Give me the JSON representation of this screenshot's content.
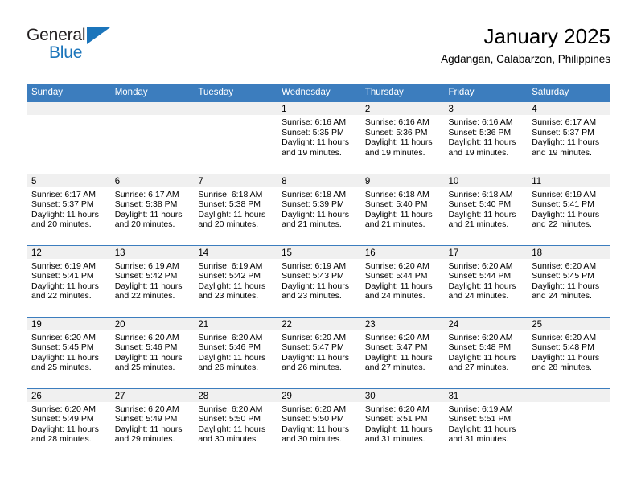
{
  "logo": {
    "word_one": "General",
    "word_two": "Blue",
    "triangle_icon": "triangle-icon",
    "accent_color": "#1b75bb"
  },
  "header": {
    "title": "January 2025",
    "subtitle": "Agdangan, Calabarzon, Philippines"
  },
  "theme": {
    "header_blue": "#3c7dbe",
    "daynum_band": "#f0f0f0",
    "text": "#000000"
  },
  "weekday_headers": [
    "Sunday",
    "Monday",
    "Tuesday",
    "Wednesday",
    "Thursday",
    "Friday",
    "Saturday"
  ],
  "weeks": [
    [
      {
        "day": "",
        "sunrise": "",
        "sunset": "",
        "daylight_line1": "",
        "daylight_line2": ""
      },
      {
        "day": "",
        "sunrise": "",
        "sunset": "",
        "daylight_line1": "",
        "daylight_line2": ""
      },
      {
        "day": "",
        "sunrise": "",
        "sunset": "",
        "daylight_line1": "",
        "daylight_line2": ""
      },
      {
        "day": "1",
        "sunrise": "Sunrise: 6:16 AM",
        "sunset": "Sunset: 5:35 PM",
        "daylight_line1": "Daylight: 11 hours",
        "daylight_line2": "and 19 minutes."
      },
      {
        "day": "2",
        "sunrise": "Sunrise: 6:16 AM",
        "sunset": "Sunset: 5:36 PM",
        "daylight_line1": "Daylight: 11 hours",
        "daylight_line2": "and 19 minutes."
      },
      {
        "day": "3",
        "sunrise": "Sunrise: 6:16 AM",
        "sunset": "Sunset: 5:36 PM",
        "daylight_line1": "Daylight: 11 hours",
        "daylight_line2": "and 19 minutes."
      },
      {
        "day": "4",
        "sunrise": "Sunrise: 6:17 AM",
        "sunset": "Sunset: 5:37 PM",
        "daylight_line1": "Daylight: 11 hours",
        "daylight_line2": "and 19 minutes."
      }
    ],
    [
      {
        "day": "5",
        "sunrise": "Sunrise: 6:17 AM",
        "sunset": "Sunset: 5:37 PM",
        "daylight_line1": "Daylight: 11 hours",
        "daylight_line2": "and 20 minutes."
      },
      {
        "day": "6",
        "sunrise": "Sunrise: 6:17 AM",
        "sunset": "Sunset: 5:38 PM",
        "daylight_line1": "Daylight: 11 hours",
        "daylight_line2": "and 20 minutes."
      },
      {
        "day": "7",
        "sunrise": "Sunrise: 6:18 AM",
        "sunset": "Sunset: 5:38 PM",
        "daylight_line1": "Daylight: 11 hours",
        "daylight_line2": "and 20 minutes."
      },
      {
        "day": "8",
        "sunrise": "Sunrise: 6:18 AM",
        "sunset": "Sunset: 5:39 PM",
        "daylight_line1": "Daylight: 11 hours",
        "daylight_line2": "and 21 minutes."
      },
      {
        "day": "9",
        "sunrise": "Sunrise: 6:18 AM",
        "sunset": "Sunset: 5:40 PM",
        "daylight_line1": "Daylight: 11 hours",
        "daylight_line2": "and 21 minutes."
      },
      {
        "day": "10",
        "sunrise": "Sunrise: 6:18 AM",
        "sunset": "Sunset: 5:40 PM",
        "daylight_line1": "Daylight: 11 hours",
        "daylight_line2": "and 21 minutes."
      },
      {
        "day": "11",
        "sunrise": "Sunrise: 6:19 AM",
        "sunset": "Sunset: 5:41 PM",
        "daylight_line1": "Daylight: 11 hours",
        "daylight_line2": "and 22 minutes."
      }
    ],
    [
      {
        "day": "12",
        "sunrise": "Sunrise: 6:19 AM",
        "sunset": "Sunset: 5:41 PM",
        "daylight_line1": "Daylight: 11 hours",
        "daylight_line2": "and 22 minutes."
      },
      {
        "day": "13",
        "sunrise": "Sunrise: 6:19 AM",
        "sunset": "Sunset: 5:42 PM",
        "daylight_line1": "Daylight: 11 hours",
        "daylight_line2": "and 22 minutes."
      },
      {
        "day": "14",
        "sunrise": "Sunrise: 6:19 AM",
        "sunset": "Sunset: 5:42 PM",
        "daylight_line1": "Daylight: 11 hours",
        "daylight_line2": "and 23 minutes."
      },
      {
        "day": "15",
        "sunrise": "Sunrise: 6:19 AM",
        "sunset": "Sunset: 5:43 PM",
        "daylight_line1": "Daylight: 11 hours",
        "daylight_line2": "and 23 minutes."
      },
      {
        "day": "16",
        "sunrise": "Sunrise: 6:20 AM",
        "sunset": "Sunset: 5:44 PM",
        "daylight_line1": "Daylight: 11 hours",
        "daylight_line2": "and 24 minutes."
      },
      {
        "day": "17",
        "sunrise": "Sunrise: 6:20 AM",
        "sunset": "Sunset: 5:44 PM",
        "daylight_line1": "Daylight: 11 hours",
        "daylight_line2": "and 24 minutes."
      },
      {
        "day": "18",
        "sunrise": "Sunrise: 6:20 AM",
        "sunset": "Sunset: 5:45 PM",
        "daylight_line1": "Daylight: 11 hours",
        "daylight_line2": "and 24 minutes."
      }
    ],
    [
      {
        "day": "19",
        "sunrise": "Sunrise: 6:20 AM",
        "sunset": "Sunset: 5:45 PM",
        "daylight_line1": "Daylight: 11 hours",
        "daylight_line2": "and 25 minutes."
      },
      {
        "day": "20",
        "sunrise": "Sunrise: 6:20 AM",
        "sunset": "Sunset: 5:46 PM",
        "daylight_line1": "Daylight: 11 hours",
        "daylight_line2": "and 25 minutes."
      },
      {
        "day": "21",
        "sunrise": "Sunrise: 6:20 AM",
        "sunset": "Sunset: 5:46 PM",
        "daylight_line1": "Daylight: 11 hours",
        "daylight_line2": "and 26 minutes."
      },
      {
        "day": "22",
        "sunrise": "Sunrise: 6:20 AM",
        "sunset": "Sunset: 5:47 PM",
        "daylight_line1": "Daylight: 11 hours",
        "daylight_line2": "and 26 minutes."
      },
      {
        "day": "23",
        "sunrise": "Sunrise: 6:20 AM",
        "sunset": "Sunset: 5:47 PM",
        "daylight_line1": "Daylight: 11 hours",
        "daylight_line2": "and 27 minutes."
      },
      {
        "day": "24",
        "sunrise": "Sunrise: 6:20 AM",
        "sunset": "Sunset: 5:48 PM",
        "daylight_line1": "Daylight: 11 hours",
        "daylight_line2": "and 27 minutes."
      },
      {
        "day": "25",
        "sunrise": "Sunrise: 6:20 AM",
        "sunset": "Sunset: 5:48 PM",
        "daylight_line1": "Daylight: 11 hours",
        "daylight_line2": "and 28 minutes."
      }
    ],
    [
      {
        "day": "26",
        "sunrise": "Sunrise: 6:20 AM",
        "sunset": "Sunset: 5:49 PM",
        "daylight_line1": "Daylight: 11 hours",
        "daylight_line2": "and 28 minutes."
      },
      {
        "day": "27",
        "sunrise": "Sunrise: 6:20 AM",
        "sunset": "Sunset: 5:49 PM",
        "daylight_line1": "Daylight: 11 hours",
        "daylight_line2": "and 29 minutes."
      },
      {
        "day": "28",
        "sunrise": "Sunrise: 6:20 AM",
        "sunset": "Sunset: 5:50 PM",
        "daylight_line1": "Daylight: 11 hours",
        "daylight_line2": "and 30 minutes."
      },
      {
        "day": "29",
        "sunrise": "Sunrise: 6:20 AM",
        "sunset": "Sunset: 5:50 PM",
        "daylight_line1": "Daylight: 11 hours",
        "daylight_line2": "and 30 minutes."
      },
      {
        "day": "30",
        "sunrise": "Sunrise: 6:20 AM",
        "sunset": "Sunset: 5:51 PM",
        "daylight_line1": "Daylight: 11 hours",
        "daylight_line2": "and 31 minutes."
      },
      {
        "day": "31",
        "sunrise": "Sunrise: 6:19 AM",
        "sunset": "Sunset: 5:51 PM",
        "daylight_line1": "Daylight: 11 hours",
        "daylight_line2": "and 31 minutes."
      },
      {
        "day": "",
        "sunrise": "",
        "sunset": "",
        "daylight_line1": "",
        "daylight_line2": ""
      }
    ]
  ]
}
